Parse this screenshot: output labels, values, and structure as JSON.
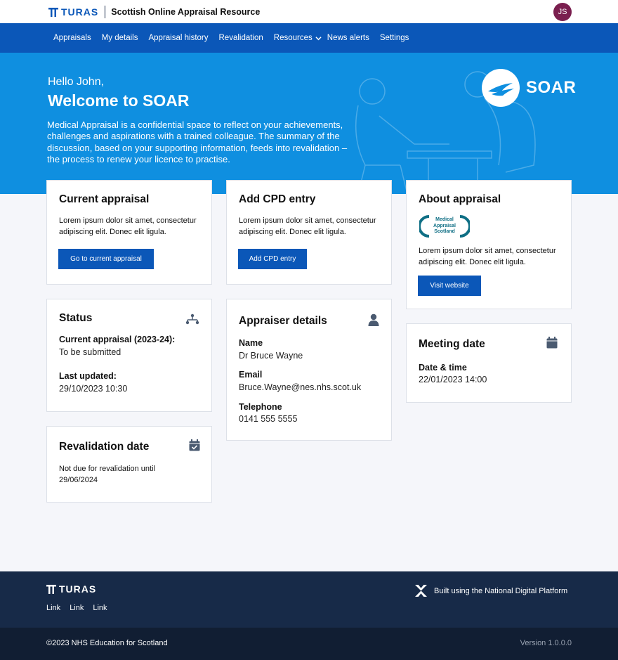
{
  "header": {
    "brand_name": "TURAS",
    "app_title": "Scottish Online Appraisal Resource",
    "user_initials": "JS"
  },
  "nav": {
    "items": [
      "Appraisals",
      "My details",
      "Appraisal history",
      "Revalidation",
      "Resources",
      "News alerts",
      "Settings"
    ]
  },
  "hero": {
    "greeting": "Hello John,",
    "title": "Welcome to SOAR",
    "intro": "Medical Appraisal is a confidential space to reflect on your achievements, challenges and aspirations with a trained colleague.  The summary of the discussion, based on your supporting information, feeds into revalidation – the process to renew your licence to practise.",
    "logo_text": "SOAR"
  },
  "cards": {
    "current_appraisal": {
      "title": "Current appraisal",
      "body": "Lorem ipsum dolor sit amet, consectetur adipiscing elit. Donec elit ligula.",
      "button": "Go to current appraisal"
    },
    "add_cpd": {
      "title": "Add CPD entry",
      "body": "Lorem ipsum dolor sit amet, consectetur adipiscing elit. Donec elit ligula.",
      "button": "Add CPD entry"
    },
    "about": {
      "title": "About appraisal",
      "logo_text": "Medical Appraisal Scotland",
      "body": "Lorem ipsum dolor sit amet, consectetur adipiscing elit. Donec elit ligula.",
      "button": "Visit website"
    },
    "status": {
      "title": "Status",
      "icon": "flow-icon",
      "label1": "Current appraisal (2023-24):",
      "value1": "To be submitted",
      "label2": "Last updated:",
      "value2": "29/10/2023 10:30"
    },
    "appraiser": {
      "title": "Appraiser details",
      "icon": "person-icon",
      "name_label": "Name",
      "name_value": "Dr Bruce Wayne",
      "email_label": "Email",
      "email_value": "Bruce.Wayne@nes.nhs.scot.uk",
      "phone_label": "Telephone",
      "phone_value": "0141 555 5555"
    },
    "meeting": {
      "title": "Meeting date",
      "icon": "calendar-icon",
      "label": "Date & time",
      "value": "22/01/2023 14:00"
    },
    "revalidation": {
      "title": "Revalidation date",
      "icon": "calendar-check-icon",
      "body": "Not due for revalidation until 29/06/2024"
    }
  },
  "footer": {
    "brand_name": "TURAS",
    "links": [
      "Link",
      "Link",
      "Link"
    ],
    "platform_text": "Built using the National Digital Platform",
    "copyright": "©2023 NHS Education for Scotland",
    "version": "Version 1.0.0.0"
  },
  "colors": {
    "nav_blue": "#0b57b8",
    "hero_blue": "#0f8fe0",
    "footer_navy": "#172a48",
    "avatar": "#7a1f4f"
  }
}
